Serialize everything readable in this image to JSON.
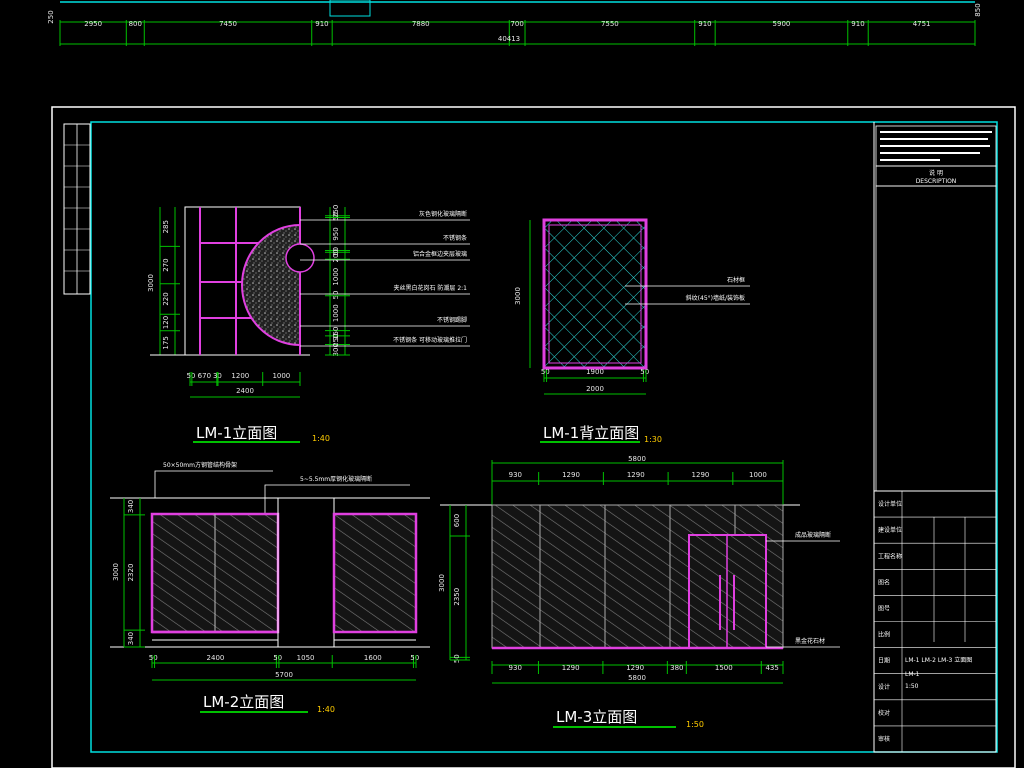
{
  "top_strip": {
    "dims": [
      "2950",
      "800",
      "7450",
      "910",
      "7880",
      "700",
      "7550",
      "910",
      "5900",
      "910",
      "4751"
    ],
    "total": "40413",
    "left_label": "250",
    "right_label": "850"
  },
  "title_block": {
    "notes_header": "说 明",
    "notes_sub": "DESCRIPTION",
    "rows": [
      "设计单位",
      "建设单位",
      "工程名称",
      "图名",
      "图号",
      "比例",
      "日期",
      "设计",
      "校对",
      "审核"
    ],
    "drawing_name": "LM-1 LM-2 LM-3 立面图",
    "drawing_no": "LM-1",
    "scale": "1:50"
  },
  "lm1": {
    "title": "LM-1立面图",
    "scale": "1:40",
    "height_total": "3000",
    "height_dims": [
      "285",
      "270",
      "220",
      "120",
      "175"
    ],
    "right_dims": [
      "250",
      "50",
      "950",
      "50",
      "200",
      "1000",
      "50",
      "1000",
      "150",
      "250",
      "300"
    ],
    "bottom_dims": [
      "50",
      "670",
      "30",
      "1200",
      "1000"
    ],
    "width_total": "2400",
    "callouts": [
      "灰色钢化玻璃隔断",
      "不锈钢条",
      "铝合金框边夹层玻璃",
      "夹丝黑白花岗石 防潮层 2:1",
      "不锈钢踢脚",
      "不锈钢条 可移动玻璃推拉门"
    ]
  },
  "lm1b": {
    "title": "LM-1背立面图",
    "scale": "1:30",
    "height": "3000",
    "bottom_dims": [
      "50",
      "1900",
      "50"
    ],
    "width_total": "2000",
    "callouts": [
      "石材框",
      "斜纹(45°)墙纸/装饰板"
    ]
  },
  "lm2": {
    "title": "LM-2立面图",
    "scale": "1:40",
    "callouts": [
      "50×50mm方钢管结构骨架",
      "5~5.5mm厚钢化玻璃隔断"
    ],
    "left_dims": [
      "340",
      "2320",
      "340"
    ],
    "height_total": "3000",
    "bottom_dims": [
      "50",
      "2400",
      "50",
      "1050",
      "1600",
      "50"
    ],
    "width_total": "5700"
  },
  "lm3": {
    "title": "LM-3立面图",
    "scale": "1:50",
    "top_total": "5800",
    "top_dims": [
      "930",
      "1290",
      "1290",
      "1290",
      "1000"
    ],
    "left_dims": [
      "600",
      "2350",
      "50"
    ],
    "height_total": "3000",
    "bottom_dims": [
      "930",
      "1290",
      "1290",
      "380",
      "1500",
      "435"
    ],
    "width_total": "5800",
    "callouts": [
      "成品玻璃隔断",
      "黑金花石材"
    ]
  }
}
